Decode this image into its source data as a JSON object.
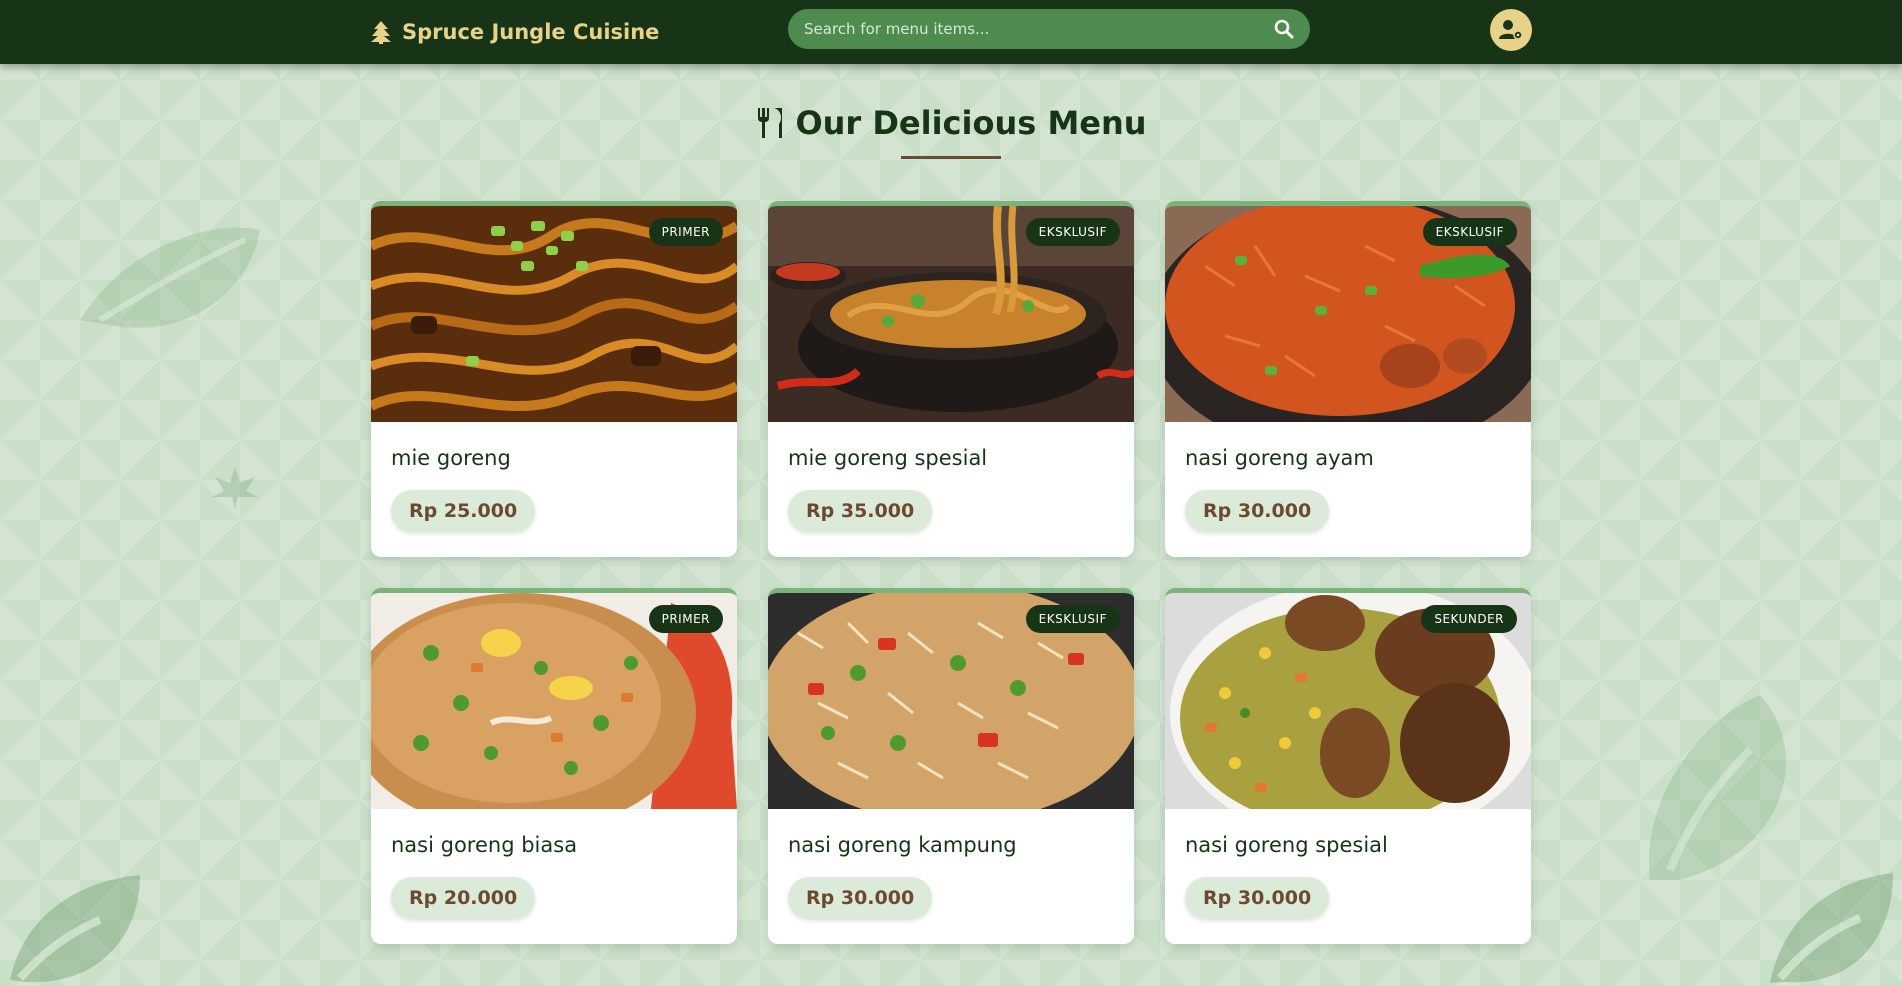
{
  "header": {
    "brand": "Spruce Jungle Cuisine",
    "search_placeholder": "Search for menu items..."
  },
  "page_title": "Our Delicious Menu",
  "menu": [
    {
      "name": "mie goreng",
      "price": "Rp 25.000",
      "badge": "PRIMER"
    },
    {
      "name": "mie goreng spesial",
      "price": "Rp 35.000",
      "badge": "EKSKLUSIF"
    },
    {
      "name": "nasi goreng ayam",
      "price": "Rp 30.000",
      "badge": "EKSKLUSIF"
    },
    {
      "name": "nasi goreng biasa",
      "price": "Rp 20.000",
      "badge": "PRIMER"
    },
    {
      "name": "nasi goreng kampung",
      "price": "Rp 30.000",
      "badge": "EKSKLUSIF"
    },
    {
      "name": "nasi goreng spesial",
      "price": "Rp 30.000",
      "badge": "SEKUNDER"
    }
  ],
  "icons": {
    "brand": "tree-icon",
    "search": "search-icon",
    "account": "user-cog-icon",
    "title": "utensils-icon"
  },
  "colors": {
    "header_bg": "#173516",
    "brand_gold": "#e8d28a",
    "search_bg": "#4d8b4e",
    "page_bg": "#c9dfc8",
    "price_text": "#6b4a30",
    "card_accent": "#7bb47a"
  }
}
